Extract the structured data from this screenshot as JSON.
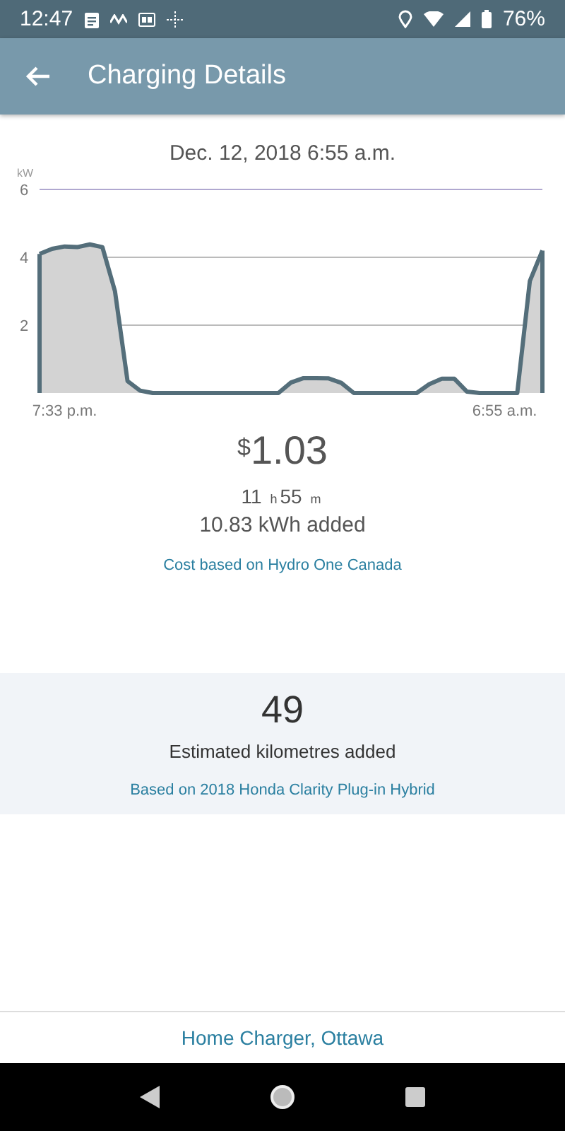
{
  "status_bar": {
    "time": "12:47",
    "battery": "76%"
  },
  "app_bar": {
    "title": "Charging Details"
  },
  "session": {
    "date": "Dec. 12, 2018 6:55 a.m.",
    "chart_data": {
      "type": "area",
      "ylabel": "kW",
      "ylim": [
        0,
        6
      ],
      "yticks": [
        2,
        4,
        6
      ],
      "categories": [
        null,
        null,
        "7:33 p.m.",
        null,
        null,
        null,
        null,
        null,
        null,
        null,
        null,
        null,
        null,
        null,
        null,
        null,
        null,
        null,
        null,
        null,
        null,
        null,
        null,
        null,
        null,
        null,
        null,
        null,
        null,
        null,
        null,
        null,
        null,
        null,
        null,
        null,
        null,
        "6:55 a.m.",
        null,
        null,
        null
      ],
      "series": [
        {
          "color": "#d3d3d3",
          "values": [
            4.1,
            4.25,
            4.32,
            4.3,
            4.38,
            4.3,
            3.0,
            0.35,
            0.07,
            0,
            0,
            0,
            0,
            0,
            0,
            0,
            0,
            0,
            0,
            0,
            0.31,
            0.44,
            0.44,
            0.43,
            0.3,
            0,
            0,
            0,
            0,
            0,
            0,
            0.26,
            0.42,
            0.42,
            0.04,
            0,
            0,
            0,
            0,
            3.3,
            4.2
          ]
        }
      ]
    },
    "currency": "$",
    "cost": "1.03",
    "duration": "11 $_{h}$55 $_{m}$",
    "energy": "10.83 kWh added",
    "cost_source": "Cost based on Hydro One Canada"
  },
  "range": {
    "value": "49",
    "label": "Estimated kilometres added",
    "source": "Based on 2018 Honda Clarity Plug-in Hybrid"
  },
  "footer": {
    "location": "Home Charger, Ottawa"
  }
}
